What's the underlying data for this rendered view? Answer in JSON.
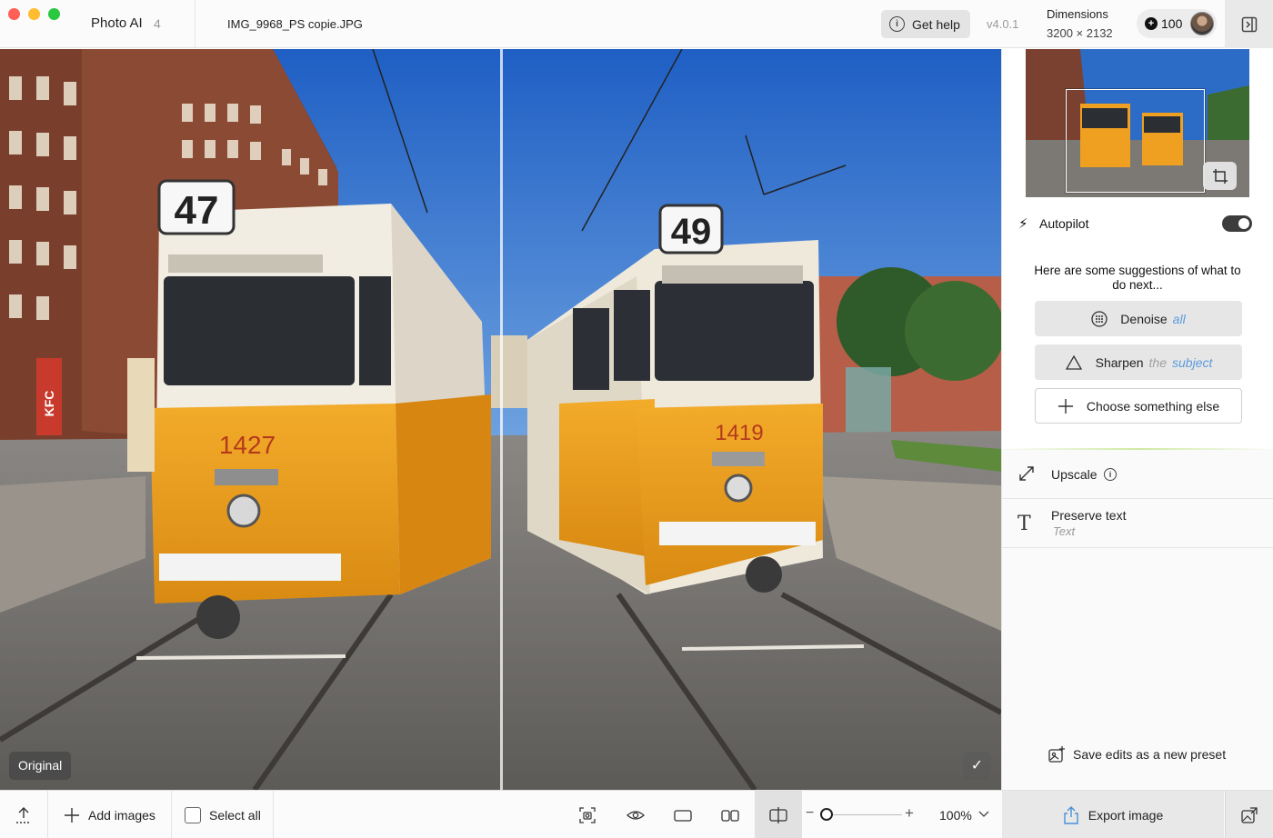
{
  "titlebar": {
    "app_title": "Photo AI",
    "app_count": "4",
    "file_name": "IMG_9968_PS copie.JPG",
    "help_label": "Get help",
    "version": "v4.0.1",
    "dimensions_label": "Dimensions",
    "dimensions_value": "3200 × 2132",
    "credits": "100"
  },
  "canvas": {
    "original_label": "Original",
    "check_glyph": "✓",
    "left_tram_route": "47",
    "left_tram_fleet": "1427",
    "right_tram_route": "49",
    "right_tram_fleet": "1419",
    "kiosk_text": "KFC"
  },
  "panel": {
    "autopilot_label": "Autopilot",
    "autopilot_on": true,
    "suggestion_text": "Here are some suggestions of what to do next...",
    "suggestions": [
      {
        "label": "Denoise",
        "qualifier": "all",
        "icon": "denoise-icon"
      },
      {
        "label": "Sharpen",
        "qualifier_prefix": "the",
        "qualifier": "subject",
        "icon": "sharpen-icon"
      },
      {
        "label": "Choose something else",
        "icon": "plus-icon"
      }
    ],
    "upscale_label": "Upscale",
    "preserve_text_label": "Preserve text",
    "preserve_text_sub": "Text",
    "preset_label": "Save edits as a new preset"
  },
  "bottombar": {
    "add_images_label": "Add images",
    "select_all_label": "Select all",
    "zoom_value": "100%",
    "zoom_level": 0.06,
    "export_label": "Export image"
  },
  "colors": {
    "accent_blue": "#5a9bdc",
    "tram_yellow": "#f0a020",
    "sky_blue": "#2f6fc9"
  }
}
